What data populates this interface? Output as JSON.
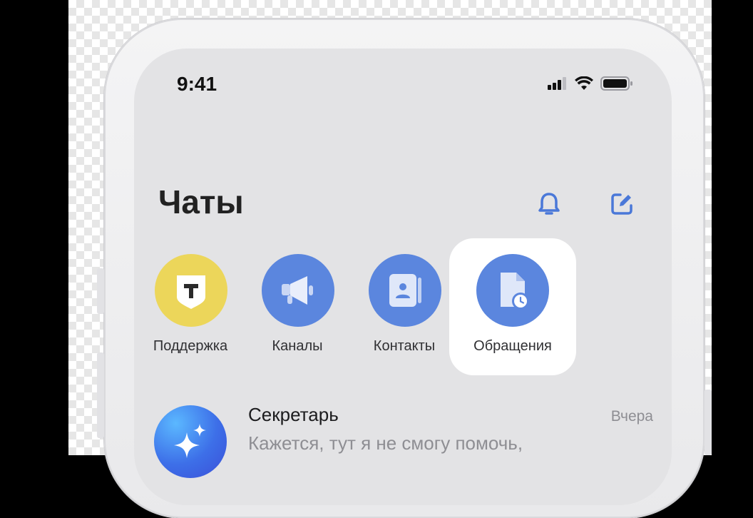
{
  "status_bar": {
    "time": "9:41",
    "icons": [
      "signal-icon",
      "wifi-icon",
      "battery-icon"
    ]
  },
  "header": {
    "title": "Чаты",
    "actions": [
      {
        "icon": "bell-icon"
      },
      {
        "icon": "edit-icon"
      }
    ]
  },
  "stories": [
    {
      "label": "Поддержка",
      "icon": "support-logo-icon",
      "color": "#ecd65a",
      "selected": false
    },
    {
      "label": "Каналы",
      "icon": "megaphone-icon",
      "color": "#5b86de",
      "selected": false
    },
    {
      "label": "Контакты",
      "icon": "contacts-icon",
      "color": "#5b86de",
      "selected": false
    },
    {
      "label": "Обращения",
      "icon": "requests-icon",
      "color": "#5b86de",
      "selected": true
    }
  ],
  "chats": [
    {
      "name": "Секретарь",
      "time": "Вчера",
      "preview": "Кажется, тут я не смогу помочь,",
      "icon": "sparkle-icon"
    }
  ],
  "colors": {
    "accent": "#4a78d8",
    "screen_bg": "#e3e3e5",
    "selected_bg": "#ffffff"
  }
}
